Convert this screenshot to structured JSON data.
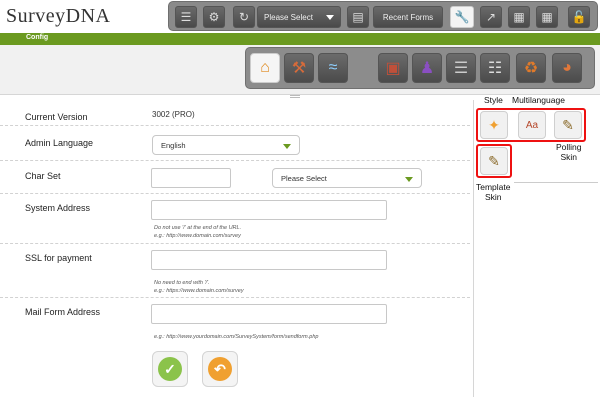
{
  "app": {
    "logo_text": "SurveyDNA",
    "section_label": "Config"
  },
  "toolbar": {
    "select_label": "Please Select",
    "recent_forms_label": "Recent Forms",
    "icons": [
      "chat-icon",
      "settings-icon",
      "sync-icon",
      "book-icon",
      "wrench-icon",
      "export-icon",
      "library-icon",
      "chart-icon",
      "unlock-icon"
    ]
  },
  "config_tabs": {
    "icons": [
      "home-icon",
      "tools-icon",
      "wireless-icon",
      "briefcase-icon",
      "users-icon",
      "database-icon",
      "network-icon",
      "recycle-icon",
      "piechart-icon"
    ]
  },
  "form": {
    "current_version": {
      "label": "Current Version",
      "value": "3002 (PRO)"
    },
    "admin_language": {
      "label": "Admin Language",
      "value": "English"
    },
    "char_set": {
      "label": "Char Set",
      "input_value": "",
      "select_value": "Please Select"
    },
    "system_address": {
      "label": "System Address",
      "value": "",
      "hint1": "Do not use '/' at the end of the URL.",
      "hint2": "e.g.: http://www.domain.com/survey"
    },
    "ssl_payment": {
      "label": "SSL for payment",
      "value": "",
      "hint1": "No need to end with '/'.",
      "hint2": "e.g.: https://www.domain.com/survey"
    },
    "mail_form_address": {
      "label": "Mail Form Address",
      "value": "",
      "hint1": "e.g.: http://www.yourdomain.com/SurveySystem/form/sendform.php"
    }
  },
  "actions": {
    "save_icon": "check-icon",
    "reset_icon": "undo-icon"
  },
  "sidebar": {
    "style_label": "Style",
    "multilanguage_label": "Multilanguage",
    "polling_skin_label": "Polling Skin",
    "template_skin_label": "Template Skin",
    "polling_skin_line1": "Polling",
    "polling_skin_line2": "Skin",
    "template_skin_line1": "Template",
    "template_skin_line2": "Skin"
  },
  "colors": {
    "brand_green": "#6b9a20",
    "toolbar_gray": "#8a8a8a",
    "highlight_red": "#e11111",
    "save_green": "#8bc34a",
    "reset_orange": "#f0a030"
  }
}
